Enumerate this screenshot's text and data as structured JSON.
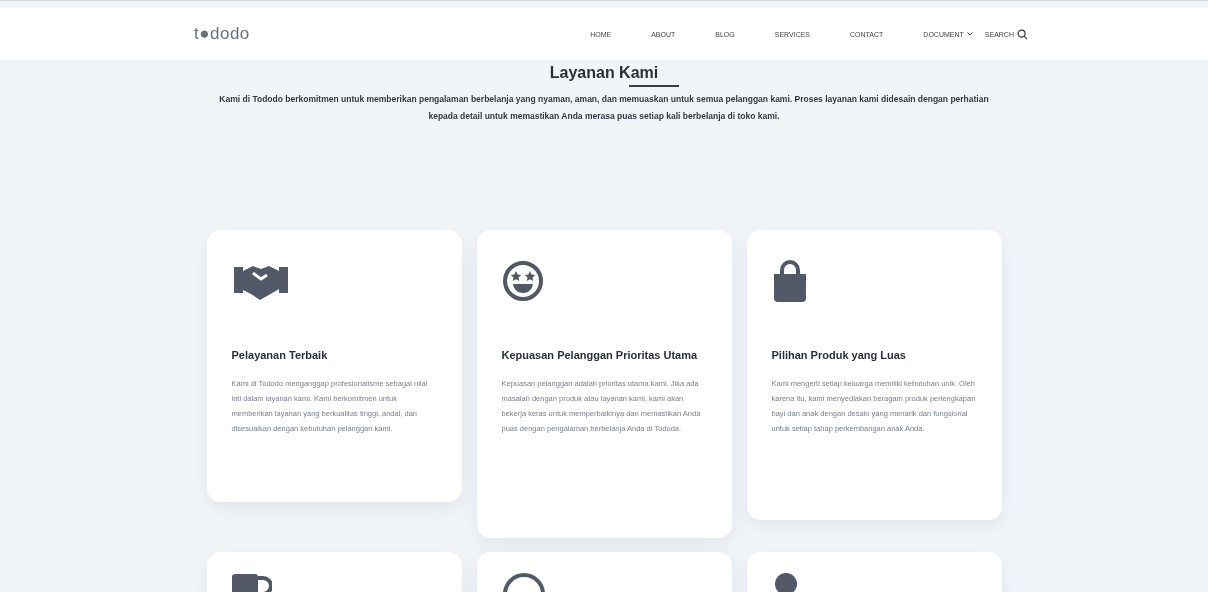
{
  "header": {
    "logo": "t●dodo",
    "nav": [
      {
        "label": "HOME",
        "dropdown": false
      },
      {
        "label": "ABOUT",
        "dropdown": false
      },
      {
        "label": "BLOG",
        "dropdown": false
      },
      {
        "label": "SERVICES",
        "dropdown": false
      },
      {
        "label": "CONTACT",
        "dropdown": false
      },
      {
        "label": "DOCUMENT",
        "dropdown": true
      }
    ],
    "search": "SEARCH"
  },
  "section": {
    "title": "Layanan Kami",
    "intro": "Kami di Tododo berkomitmen untuk memberikan pengalaman berbelanja yang nyaman, aman, dan memuaskan untuk semua pelanggan kami. Proses layanan kami didesain dengan perhatian kepada detail untuk memastikan Anda merasa puas setiap kali berbelanja di toko kami."
  },
  "cards": [
    {
      "title": "Pelayanan Terbaik",
      "text": "Kami di Tododo menganggap profesionalisme sebagai nilai inti dalam layanan kami. Kami berkomitmen untuk memberikan layanan yang berkualitas tinggi, andal, dan disesuaikan dengan kebutuhan pelanggan kami."
    },
    {
      "title": "Kepuasan Pelanggan Prioritas Utama",
      "text": "Kepuasan pelanggan adalah prioritas utama kami. Jika ada masalah dengan produk atau layanan kami, kami akan bekerja keras untuk memperbaikinya dan memastikan Anda puas dengan pengalaman berbelanja Anda di Tododa."
    },
    {
      "title": "Pilihan Produk yang Luas",
      "text": "Kami mengerti setiap keluarga memiliki kebutuhan unik. Oleh karena itu, kami menyediakan beragam produk perlengkapan bayi dan anak dengan desain yang menarik dan fungsional untuk setiap tahap perkembangan anak Anda."
    }
  ]
}
